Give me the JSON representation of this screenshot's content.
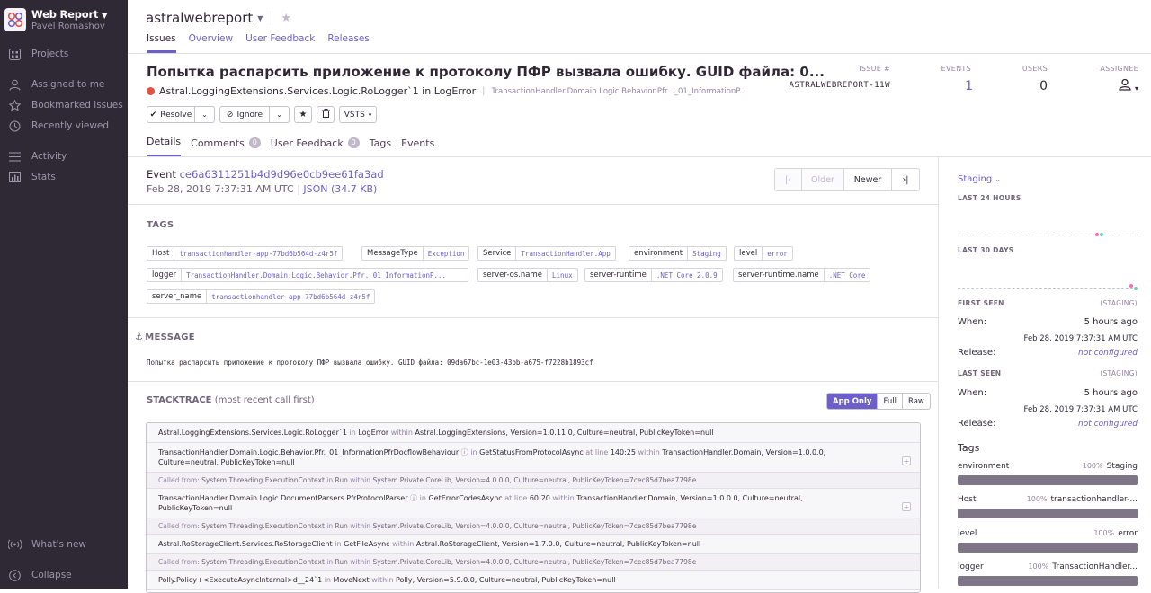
{
  "sidebar": {
    "org_name": "Web Report",
    "org_user": "Pavel Romashov",
    "items": [
      {
        "label": "Projects",
        "icon": "projects-icon"
      },
      {
        "label": "Assigned to me",
        "icon": "user-icon"
      },
      {
        "label": "Bookmarked issues",
        "icon": "star-icon"
      },
      {
        "label": "Recently viewed",
        "icon": "history-icon"
      },
      {
        "label": "Activity",
        "icon": "activity-icon"
      },
      {
        "label": "Stats",
        "icon": "stats-icon"
      },
      {
        "label": "What's new",
        "icon": "broadcast-icon"
      },
      {
        "label": "Collapse",
        "icon": "collapse-icon"
      }
    ]
  },
  "header": {
    "project": "astralwebreport",
    "tabs": [
      "Issues",
      "Overview",
      "User Feedback",
      "Releases"
    ]
  },
  "issue": {
    "title": "Попытка распарсить приложение к протоколу ПФР вызвала ошибку. GUID файла: 0...",
    "culprit": "Astral.LoggingExtensions.Services.Logic.RoLogger`1 in LogError",
    "location": "TransactionHandler.Domain.Logic.Behavior.Pfr..._01_InformationP...",
    "stats": {
      "issue_label": "ISSUE #",
      "issue_value": "ASTRALWEBREPORT-11W",
      "events_label": "EVENTS",
      "events_value": "1",
      "users_label": "USERS",
      "users_value": "0",
      "assignee_label": "ASSIGNEE"
    },
    "actions": {
      "resolve": "Resolve",
      "ignore": "Ignore",
      "vsts": "VSTS"
    }
  },
  "detail_tabs": [
    {
      "label": "Details",
      "badge": ""
    },
    {
      "label": "Comments",
      "badge": "0"
    },
    {
      "label": "User Feedback",
      "badge": "0"
    },
    {
      "label": "Tags",
      "badge": ""
    },
    {
      "label": "Events",
      "badge": ""
    }
  ],
  "event": {
    "label": "Event",
    "id": "ce6a6311251b4d9d96e0cb9ee61fa3ad",
    "date": "Feb 28, 2019 7:37:31 AM UTC",
    "json": "JSON (34.7 KB)",
    "pager": {
      "first": "|‹",
      "older": "Older",
      "newer": "Newer",
      "last": "›|"
    }
  },
  "tags": {
    "heading": "TAGS",
    "items": [
      {
        "k": "Host",
        "v": "transactionhandler-app-77bd6b564d-z4r5f"
      },
      {
        "k": "MessageType",
        "v": "Exception"
      },
      {
        "k": "Service",
        "v": "TransactionHandler.App"
      },
      {
        "k": "environment",
        "v": "Staging"
      },
      {
        "k": "level",
        "v": "error"
      },
      {
        "k": "logger",
        "v": "TransactionHandler.Domain.Logic.Behavior.Pfr._01_InformationP..."
      },
      {
        "k": "server-os.name",
        "v": "Linux"
      },
      {
        "k": "server-runtime",
        "v": ".NET Core 2.0.9"
      },
      {
        "k": "server-runtime.name",
        "v": ".NET Core"
      },
      {
        "k": "server_name",
        "v": "transactionhandler-app-77bd6b564d-z4r5f"
      }
    ]
  },
  "message": {
    "heading": "MESSAGE",
    "text": "Попытка распарсить приложение к протоколу ПФР вызвала ошибку. GUID файла: 09da67bc-1e03-43bb-a675-f7228b1893cf"
  },
  "stacktrace": {
    "heading": "STACKTRACE",
    "sub": "(most recent call first)",
    "views": [
      "App Only",
      "Full",
      "Raw"
    ],
    "frames": [
      {
        "fn": "Astral.LoggingExtensions.Services.Logic.RoLogger`1",
        "in": "in",
        "method": "LogError",
        "within": "within",
        "module": "Astral.LoggingExtensions, Version=1.0.11.0, Culture=neutral, PublicKeyToken=null",
        "line2": ""
      },
      {
        "fn": "TransactionHandler.Domain.Logic.Behavior.Pfr._01_InformationPfrDocflowBehaviour",
        "in": "in",
        "method": "GetStatusFromProtocolAsync",
        "at": "at line",
        "line": "140:25",
        "within": "within",
        "module": "TransactionHandler.Domain, Version=1.0.0.0,",
        "line2": "Culture=neutral, PublicKeyToken=null"
      },
      {
        "fn": "TransactionHandler.Domain.Logic.DocumentParsers.PfrProtocolParser",
        "in": "in",
        "method": "GetErrorCodesAsync",
        "at": "at line",
        "line": "60:20",
        "within": "within",
        "module": "TransactionHandler.Domain, Version=1.0.0.0, Culture=neutral,",
        "line2": "PublicKeyToken=null"
      },
      {
        "fn": "Astral.RoStorageClient.Services.RoStorageClient",
        "in": "in",
        "method": "GetFileAsync",
        "within": "within",
        "module": "Astral.RoStorageClient, Version=1.7.0.0, Culture=neutral, PublicKeyToken=null",
        "line2": ""
      },
      {
        "fn": "Polly.Policy+<ExecuteAsyncInternal>d__24`1",
        "in": "in",
        "method": "MoveNext",
        "within": "within",
        "module": "Polly, Version=5.9.0.0, Culture=neutral, PublicKeyToken=null",
        "line2": ""
      }
    ],
    "called": {
      "prefix": "Called from:",
      "fn": "System.Threading.ExecutionContext",
      "in": "in",
      "method": "Run",
      "within": "within",
      "module": "System.Private.CoreLib, Version=4.0.0.0, Culture=neutral, PublicKeyToken=7cec85d7bea7798e"
    }
  },
  "right": {
    "environment": "Staging",
    "last24": "LAST 24 HOURS",
    "last30": "LAST 30 DAYS",
    "first_seen": {
      "label": "FIRST SEEN",
      "env": "(STAGING)",
      "when_k": "When:",
      "when_v": "5 hours ago",
      "date": "Feb 28, 2019 7:37:31 AM UTC",
      "release_k": "Release:",
      "release_v": "not configured"
    },
    "last_seen": {
      "label": "LAST SEEN",
      "env": "(STAGING)",
      "when_k": "When:",
      "when_v": "5 hours ago",
      "date": "Feb 28, 2019 7:37:31 AM UTC",
      "release_k": "Release:",
      "release_v": "not configured"
    },
    "tags_heading": "Tags",
    "tag_bars": [
      {
        "k": "environment",
        "pct": "100%",
        "v": "Staging",
        "fill": 1.0
      },
      {
        "k": "Host",
        "pct": "100%",
        "v": "transactionhandler-...",
        "fill": 1.0
      },
      {
        "k": "level",
        "pct": "100%",
        "v": "error",
        "fill": 1.0
      },
      {
        "k": "logger",
        "pct": "100%",
        "v": "TransactionHandler...",
        "fill": 1.0
      }
    ]
  },
  "colors": {
    "accent": "#6c5fc7",
    "sidebar_bg": "#2f2936",
    "error": "#e35141"
  }
}
